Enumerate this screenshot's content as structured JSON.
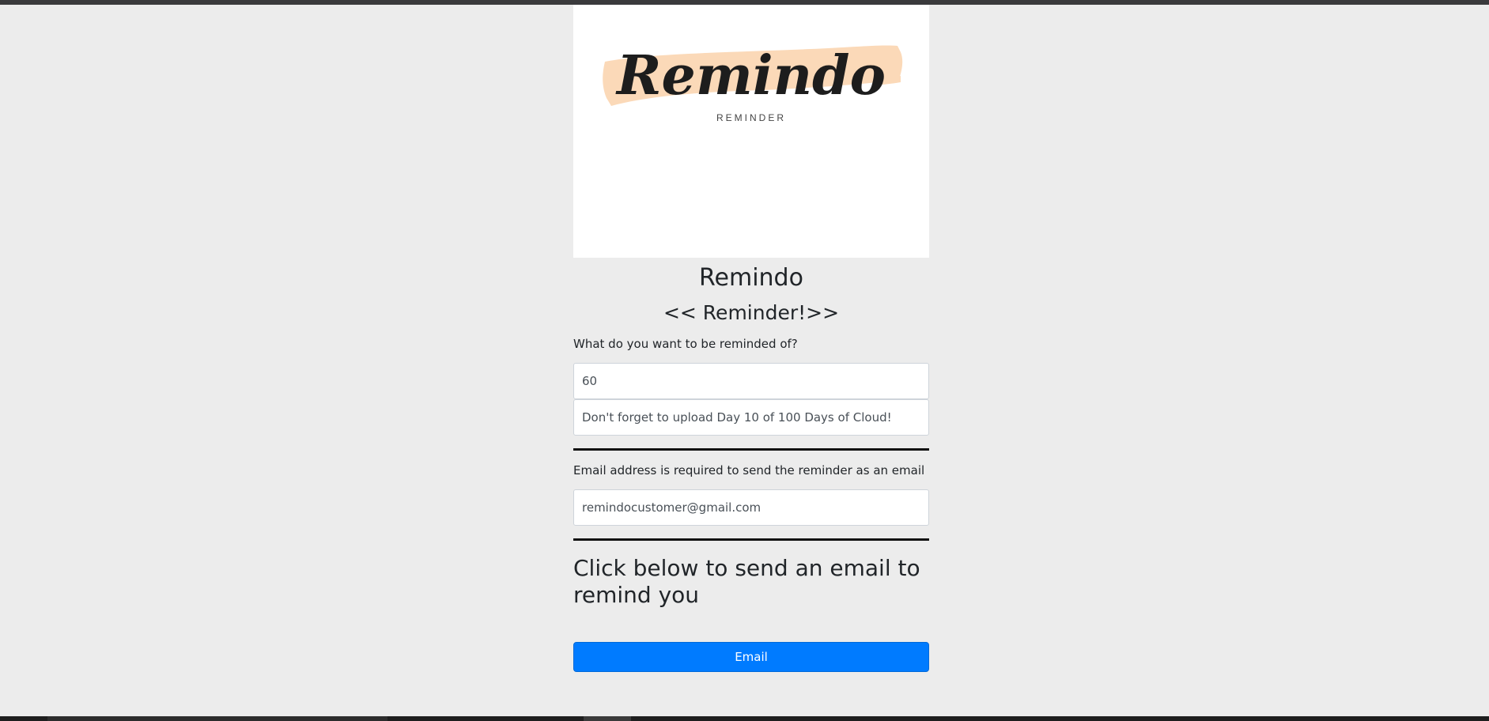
{
  "logo": {
    "brand": "Remindo",
    "tagline": "REMINDER"
  },
  "header": {
    "title": "Remindo",
    "subtitle": "<< Reminder!>>"
  },
  "reminder_section": {
    "label": "What do you want to be reminded of?",
    "minutes_value": "60",
    "message_value": "Don't forget to upload Day 10 of 100 Days of Cloud!"
  },
  "email_section": {
    "label": "Email address is required to send the reminder as an email",
    "email_value": "remindocustomer@gmail.com"
  },
  "cta": {
    "text": "Click below to send an email to remind you",
    "button_label": "Email"
  },
  "colors": {
    "page_background": "#ececec",
    "button": "#007bff",
    "brush_stroke": "#fbd9b8"
  }
}
